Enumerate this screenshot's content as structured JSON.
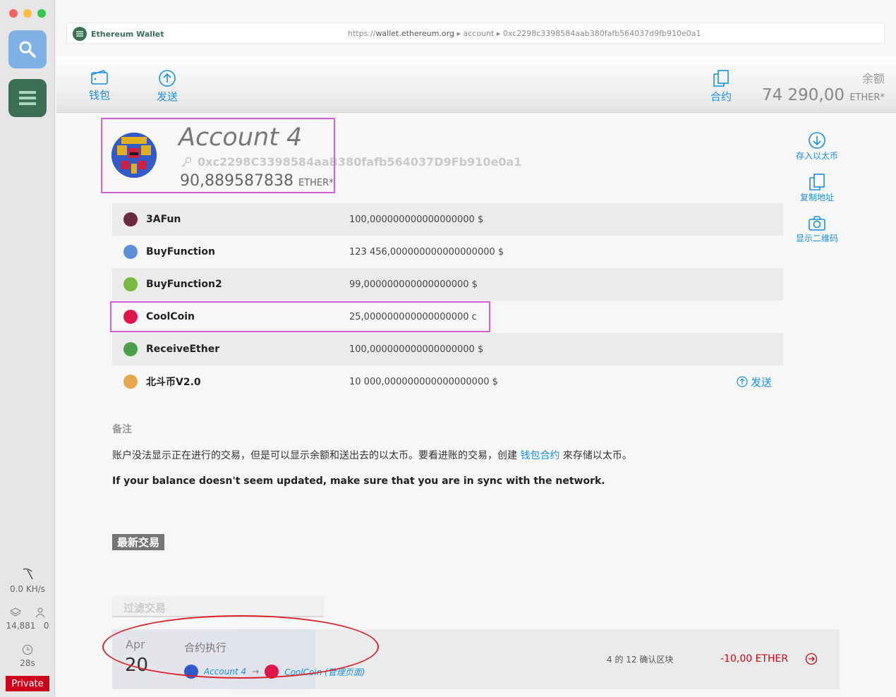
{
  "dock": {
    "hashrate": "0.0 KH/s",
    "blocks": "14,881",
    "peers": "0",
    "last_block_time": "28s",
    "network": "Private"
  },
  "addressbar": {
    "app_name": "Ethereum Wallet",
    "url_scheme": "https://",
    "url_host": "wallet.ethereum.org",
    "url_path1": "account",
    "url_path2": "0xc2298c3398584aab380fafb564037d9fb910e0a1"
  },
  "nav": {
    "wallets_label": "钱包",
    "send_label": "发送",
    "contracts_label": "合约",
    "balance_label": "余额",
    "balance_value": "74 290,00",
    "balance_unit": "ETHER*"
  },
  "account": {
    "name": "Account 4",
    "address": "0xc2298C3398584aaB380fafb564037D9Fb910e0a1",
    "balance": "90,889587838",
    "balance_unit": "ETHER*"
  },
  "actions": {
    "deposit": "存入以太币",
    "copy_address": "复制地址",
    "show_qr": "显示二维码"
  },
  "tokens": [
    {
      "name": "3AFun",
      "amount": "100,000000000000000000 $",
      "color": "#6b2a3e"
    },
    {
      "name": "BuyFunction",
      "amount": "123 456,000000000000000000 $",
      "color": "#5b8fd8"
    },
    {
      "name": "BuyFunction2",
      "amount": "99,000000000000000000 $",
      "color": "#7ab83f"
    },
    {
      "name": "CoolCoin",
      "amount": "25,000000000000000000 c",
      "color": "#e0154a"
    },
    {
      "name": "ReceiveEther",
      "amount": "100,000000000000000000 $",
      "color": "#4aa04a"
    },
    {
      "name": "北斗币V2.0",
      "amount": "10 000,000000000000000000 $",
      "color": "#e8a54a"
    }
  ],
  "token_send_label": "发送",
  "notes": {
    "title": "备注",
    "text_before": "账户没法显示正在进行的交易，但是可以显示余额和送出去的以太币。要看进账的交易，创建 ",
    "link": "钱包合约",
    "text_after": " 來存储以太币。",
    "sync_warning": "If your balance doesn't seem updated, make sure that you are in sync with the network."
  },
  "latest_transactions_label": "最新交易",
  "filter_placeholder": "过滤交易",
  "transaction": {
    "month": "Apr",
    "day": "20",
    "type": "合约执行",
    "from": "Account 4",
    "to": "CoolCoin (管理页面)",
    "confirmations": "4 的 12 确认区块",
    "amount": "-10,00 ETHER"
  }
}
